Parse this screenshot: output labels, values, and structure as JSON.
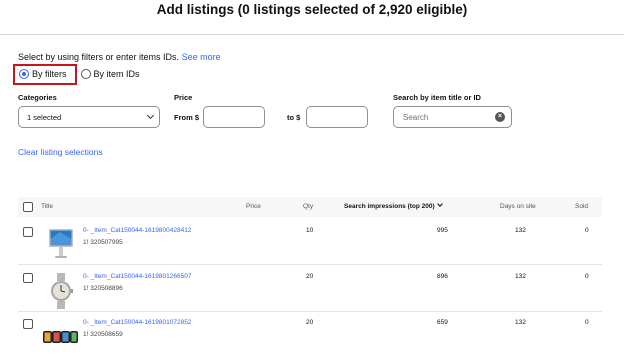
{
  "header": {
    "title": "Add listings (0 listings selected of 2,920 eligible)"
  },
  "instructions": {
    "text": "Select by using filters or enter items IDs.",
    "link": "See more"
  },
  "mode": {
    "options": [
      {
        "label": "By filters",
        "selected": true
      },
      {
        "label": "By item IDs",
        "selected": false
      }
    ]
  },
  "filters": {
    "categories_label": "Categories",
    "categories_value": "1 selected",
    "price_label": "Price",
    "from_label": "From $",
    "to_label": "to $",
    "from_value": "",
    "to_value": "",
    "search_label": "Search by item title or ID",
    "search_placeholder": "Search"
  },
  "clear_link": "Clear listing selections",
  "table": {
    "headers": {
      "title": "Title",
      "price": "Price",
      "qty": "Qty",
      "impressions": "Search impressions (top 200)",
      "days": "Days on site",
      "sold": "Sold"
    },
    "rows": [
      {
        "link": "0-   _Item_Cat150044-1619800428412",
        "id": "1!  320507995",
        "price": "",
        "qty": "10",
        "impressions": "995",
        "days": "132",
        "sold": "0",
        "image": "monitor-icon"
      },
      {
        "link": "0-   _Item_Cat150044-1619801266507",
        "id": "1!  320508896",
        "price": "",
        "qty": "20",
        "impressions": "896",
        "days": "132",
        "sold": "0",
        "image": "watch-icon"
      },
      {
        "link": "0-   _Item_Cat150044-1619801072852",
        "id": "1!  320508659",
        "price": "",
        "qty": "20",
        "impressions": "659",
        "days": "132",
        "sold": "0",
        "image": "smartwatches-icon"
      }
    ]
  },
  "colors": {
    "link": "#3665f3",
    "highlight": "#c4161c"
  }
}
